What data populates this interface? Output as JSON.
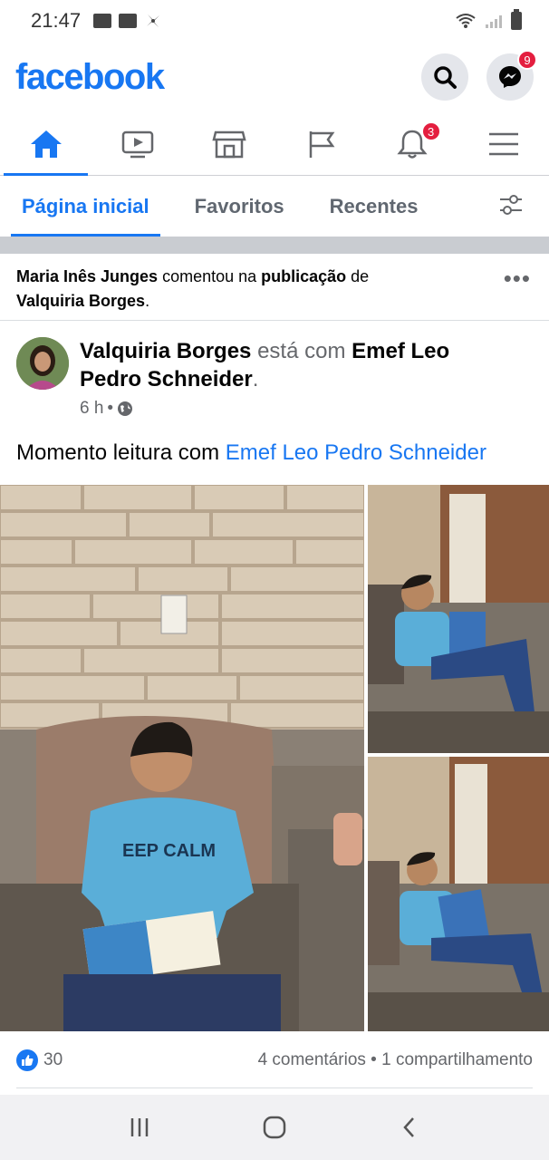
{
  "status_bar": {
    "time": "21:47"
  },
  "header": {
    "logo": "facebook",
    "messenger_badge": "9"
  },
  "nav": {
    "notifications_badge": "3"
  },
  "feed_tabs": [
    "Página inicial",
    "Favoritos",
    "Recentes"
  ],
  "activity": {
    "actor": "Maria Inês Junges",
    "verb": " comentou na ",
    "object": "publicação",
    "prep": " de",
    "owner": "Valquiria Borges",
    "end": "."
  },
  "post": {
    "author": "Valquiria Borges",
    "with_text": " está com ",
    "tagged_line1": "Emef Leo",
    "tagged_line2": "Pedro Schneider",
    "period": ".",
    "time": "6 h",
    "dot": "•",
    "text": "Momento leitura com ",
    "text_link": "Emef Leo Pedro Schneider"
  },
  "reactions": {
    "likes": "30",
    "comments": "4 comentários",
    "sep": " • ",
    "shares": "1 compartilhamento"
  },
  "colors": {
    "brand": "#1877f2",
    "badge": "#e41e3f"
  }
}
